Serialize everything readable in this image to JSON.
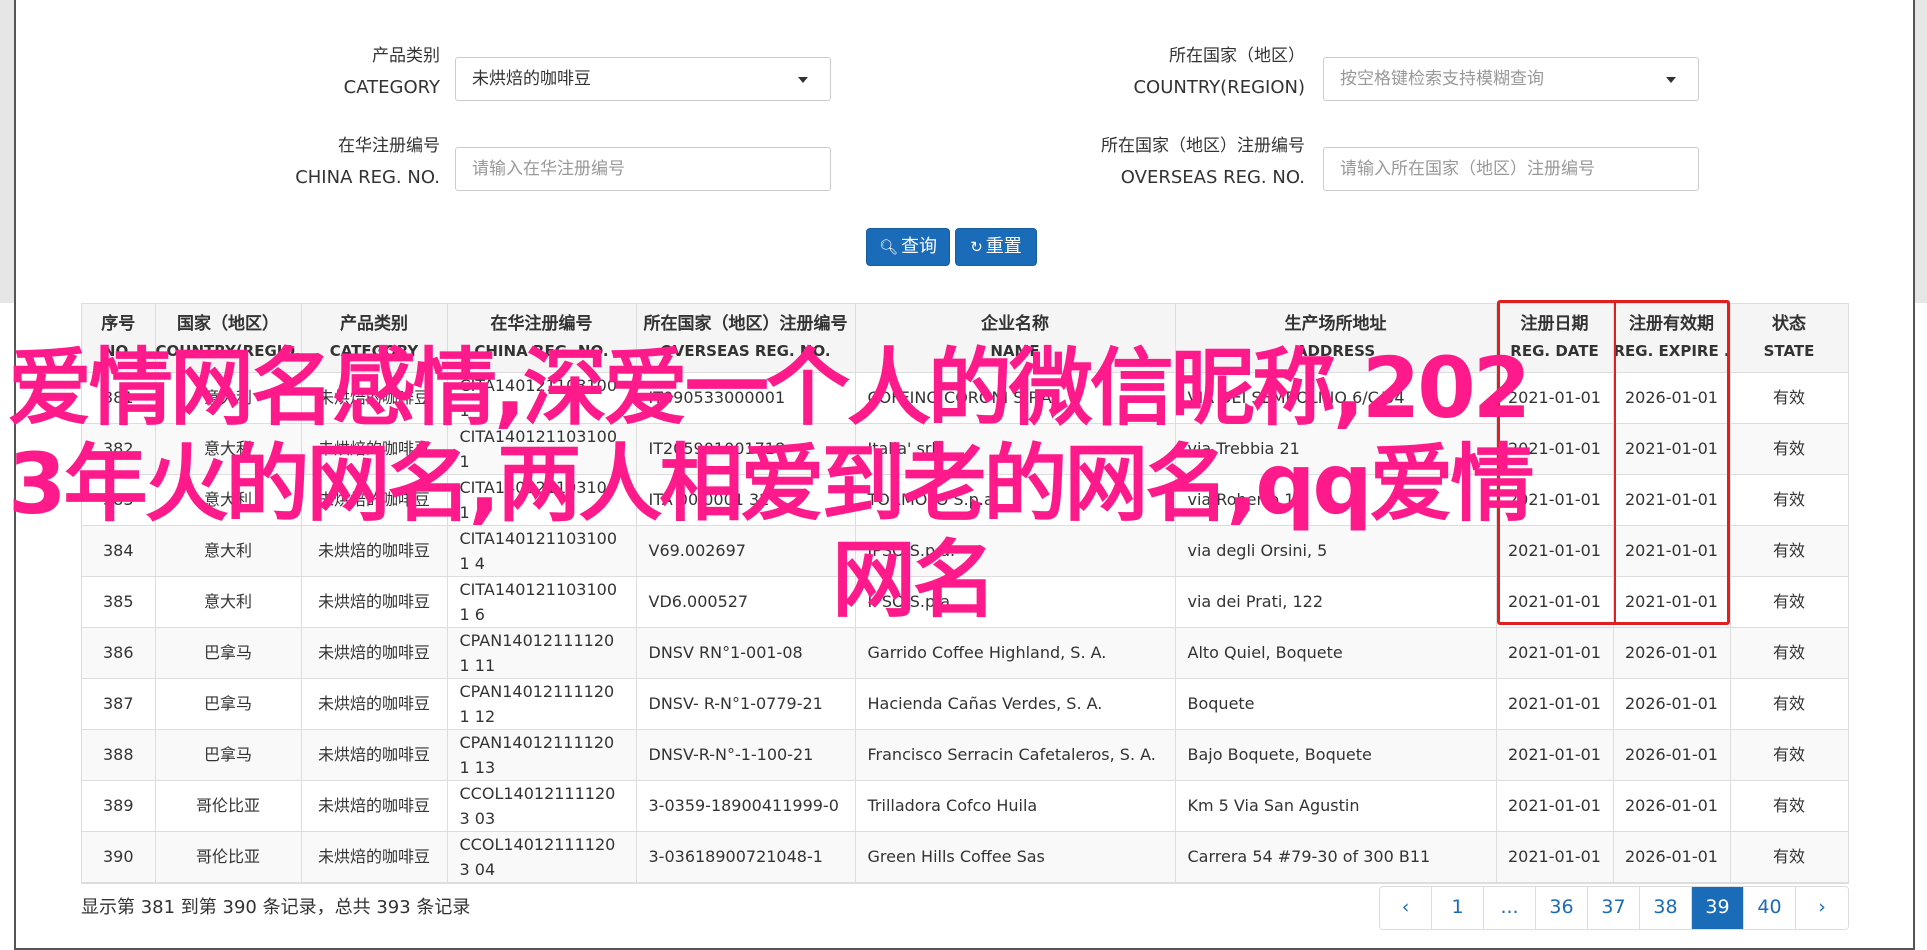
{
  "form": {
    "category": {
      "label_zh": "产品类别",
      "label_en": "CATEGORY",
      "value": "未烘焙的咖啡豆"
    },
    "country": {
      "label_zh": "所在国家（地区）",
      "label_en": "COUNTRY(REGION)",
      "placeholder": "按空格键检索支持模糊查询"
    },
    "china_reg": {
      "label_zh": "在华注册编号",
      "label_en": "CHINA REG. NO.",
      "placeholder": "请输入在华注册编号"
    },
    "overseas_reg": {
      "label_zh": "所在国家（地区）注册编号",
      "label_en": "OVERSEAS REG. NO.",
      "placeholder": "请输入所在国家（地区）注册编号"
    },
    "query_button": "查询",
    "reset_button": "重置"
  },
  "table": {
    "columns": [
      {
        "zh": "序号",
        "en": "NO."
      },
      {
        "zh": "国家（地区）",
        "en": "COUNTRY(REGIO..."
      },
      {
        "zh": "产品类别",
        "en": "CATEGORY"
      },
      {
        "zh": "在华注册编号",
        "en": "CHINA REG. NO."
      },
      {
        "zh": "所在国家（地区）注册编号",
        "en": "OVERSEAS REG. NO."
      },
      {
        "zh": "企业名称",
        "en": "NAME"
      },
      {
        "zh": "生产场所地址",
        "en": "ADDRESS"
      },
      {
        "zh": "注册日期",
        "en": "REG. DATE"
      },
      {
        "zh": "注册有效期",
        "en": "REG. EXPIRE ..."
      },
      {
        "zh": "状态",
        "en": "STATE"
      }
    ],
    "rows": [
      [
        "381",
        "意大利",
        "未烘焙的咖啡豆",
        "CITA1401211031001",
        "IT090533000001",
        "COFFINO CORONI S.P.A.",
        "VIA DEI SEMBOLINO 6/C/54",
        "2021-01-01",
        "2026-01-01",
        "有效"
      ],
      [
        "382",
        "意大利",
        "未烘焙的咖啡豆",
        "CITA1401211031001",
        "IT205901001718",
        "Italia' srl",
        "via Trebbia 21",
        "2021-01-01",
        "2021-01-01",
        "有效"
      ],
      [
        "383",
        "意大利",
        "未烘焙的咖啡豆",
        "CITA1401211031001",
        "ITA 00 0001 32",
        "TORMOLO S.p.a",
        "via Roberto 16",
        "2021-01-01",
        "2021-01-01",
        "有效"
      ],
      [
        "384",
        "意大利",
        "未烘焙的咖啡豆",
        "CITA1401211031001 4",
        "V69.002697",
        "IPSO S.p.a.",
        "via degli Orsini, 5",
        "2021-01-01",
        "2021-01-01",
        "有效"
      ],
      [
        "385",
        "意大利",
        "未烘焙的咖啡豆",
        "CITA1401211031001 6",
        "VD6.000527",
        "IPSO S.p.a.",
        "via dei Prati, 122",
        "2021-01-01",
        "2021-01-01",
        "有效"
      ],
      [
        "386",
        "巴拿马",
        "未烘焙的咖啡豆",
        "CPAN140121111201 11",
        "DNSV RN°1-001-08",
        "Garrido Coffee Highland, S. A.",
        "Alto Quiel, Boquete",
        "2021-01-01",
        "2026-01-01",
        "有效"
      ],
      [
        "387",
        "巴拿马",
        "未烘焙的咖啡豆",
        "CPAN140121111201 12",
        "DNSV- R-N°1-0779-21",
        "Hacienda Cañas Verdes, S. A.",
        "Boquete",
        "2021-01-01",
        "2026-01-01",
        "有效"
      ],
      [
        "388",
        "巴拿马",
        "未烘焙的咖啡豆",
        "CPAN140121111201 13",
        "DNSV-R-N°-1-100-21",
        "Francisco Serracin Cafetaleros, S. A.",
        "Bajo Boquete, Boquete",
        "2021-01-01",
        "2026-01-01",
        "有效"
      ],
      [
        "389",
        "哥伦比亚",
        "未烘焙的咖啡豆",
        "CCOL140121111203 03",
        "3-0359-18900411999-0",
        "Trilladora Cofco Huila",
        "Km 5 Via San Agustin",
        "2021-01-01",
        "2026-01-01",
        "有效"
      ],
      [
        "390",
        "哥伦比亚",
        "未烘焙的咖啡豆",
        "CCOL140121111203 04",
        "3-03618900721048-1",
        "Green Hills Coffee Sas",
        "Carrera 54 #79-30 of 300 B11",
        "2021-01-01",
        "2026-01-01",
        "有效"
      ]
    ]
  },
  "footer": {
    "info": "显示第 381 到第 390 条记录，总共 393 条记录",
    "pages": [
      "‹",
      "1",
      "...",
      "36",
      "37",
      "38",
      "39",
      "40",
      "›"
    ],
    "active_page": "39"
  },
  "overlay": {
    "line1": "爱情网名感情,深爱一个人的微信昵称,202",
    "line2": "3年火的网名,两人相爱到老的网名,qq爱情",
    "line3": "网名"
  },
  "colors": {
    "primary": "#1a6bb8",
    "highlight_box": "#e02020",
    "overlay_text": "#ff1a8c"
  }
}
